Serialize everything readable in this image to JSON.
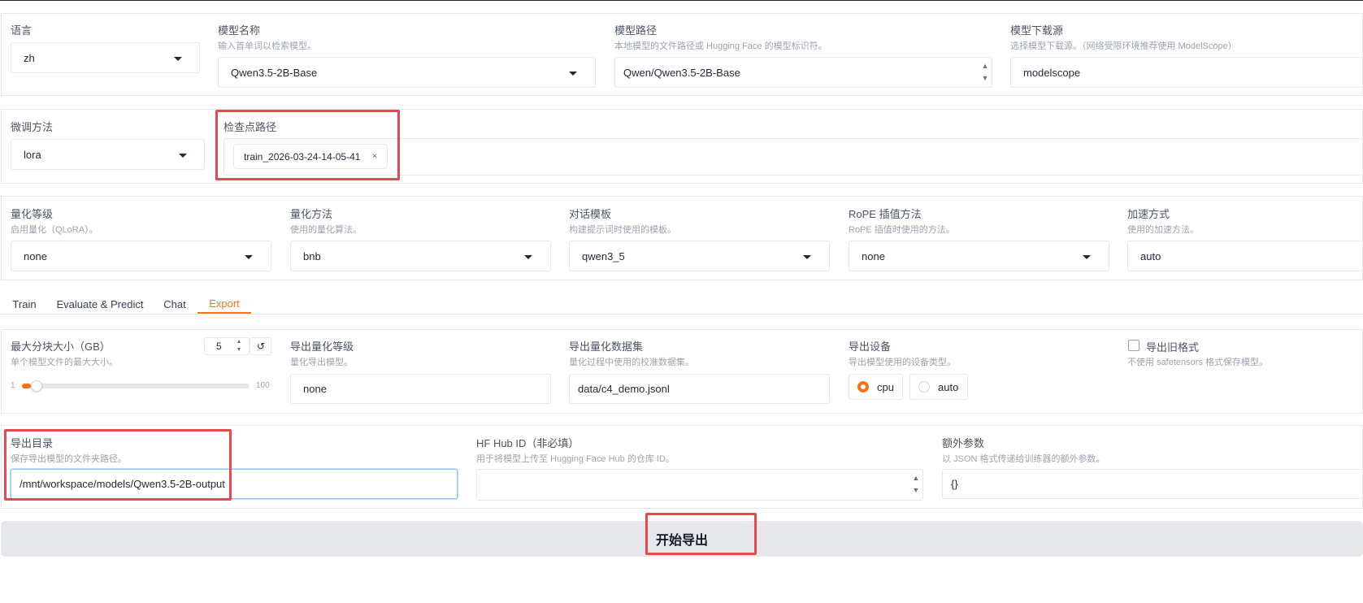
{
  "row1": {
    "lang": {
      "label": "语言",
      "value": "zh"
    },
    "model_name": {
      "label": "模型名称",
      "info": "输入首单词以检索模型。",
      "value": "Qwen3.5-2B-Base"
    },
    "model_path": {
      "label": "模型路径",
      "info": "本地模型的文件路径或 Hugging Face 的模型标识符。",
      "value": "Qwen/Qwen3.5-2B-Base"
    },
    "hub": {
      "label": "模型下载源",
      "info": "选择模型下载源。（网络受限环境推荐使用 ModelScope）",
      "value": "modelscope"
    }
  },
  "row2": {
    "finetune": {
      "label": "微调方法",
      "value": "lora"
    },
    "checkpoint": {
      "label": "检查点路径",
      "chip": "train_2026-03-24-14-05-41",
      "chip_close": "×"
    }
  },
  "row3": {
    "quant_bit": {
      "label": "量化等级",
      "info": "启用量化（QLoRA）。",
      "value": "none"
    },
    "quant_method": {
      "label": "量化方法",
      "info": "使用的量化算法。",
      "value": "bnb"
    },
    "template": {
      "label": "对话模板",
      "info": "构建提示词时使用的模板。",
      "value": "qwen3_5"
    },
    "rope": {
      "label": "RoPE 插值方法",
      "info": "RoPE 插值时使用的方法。",
      "value": "none"
    },
    "booster": {
      "label": "加速方式",
      "info": "使用的加速方法。",
      "value": "auto"
    }
  },
  "tabs": [
    {
      "label": "Train",
      "active": false
    },
    {
      "label": "Evaluate & Predict",
      "active": false
    },
    {
      "label": "Chat",
      "active": false
    },
    {
      "label": "Export",
      "active": true
    }
  ],
  "export": {
    "shard": {
      "label": "最大分块大小（GB）",
      "info": "单个模型文件的最大大小。",
      "value": "5",
      "min": "1",
      "max": "100",
      "fraction": 0.04,
      "reset": "↺"
    },
    "quant_bit": {
      "label": "导出量化等级",
      "info": "量化导出模型。",
      "value": "none"
    },
    "quant_dataset": {
      "label": "导出量化数据集",
      "info": "量化过程中使用的校准数据集。",
      "value": "data/c4_demo.jsonl"
    },
    "device": {
      "label": "导出设备",
      "info": "导出模型使用的设备类型。",
      "options": [
        "cpu",
        "auto"
      ],
      "selected": "cpu"
    },
    "legacy": {
      "label": "导出旧格式",
      "info": "不使用 safetensors 格式保存模型。",
      "checked": false
    },
    "dir": {
      "label": "导出目录",
      "info": "保存导出模型的文件夹路径。",
      "value": "/mnt/workspace/models/Qwen3.5-2B-output"
    },
    "hub_id": {
      "label": "HF Hub ID（非必填）",
      "info": "用于将模型上传至 Hugging Face Hub 的仓库 ID。",
      "value": ""
    },
    "extra": {
      "label": "额外参数",
      "info": "以 JSON 格式传递给训练器的额外参数。",
      "value": "{}"
    },
    "button": "开始导出"
  },
  "colors": {
    "accent": "#f97316",
    "highlight": "#e5484d",
    "border": "#e5e7eb"
  }
}
